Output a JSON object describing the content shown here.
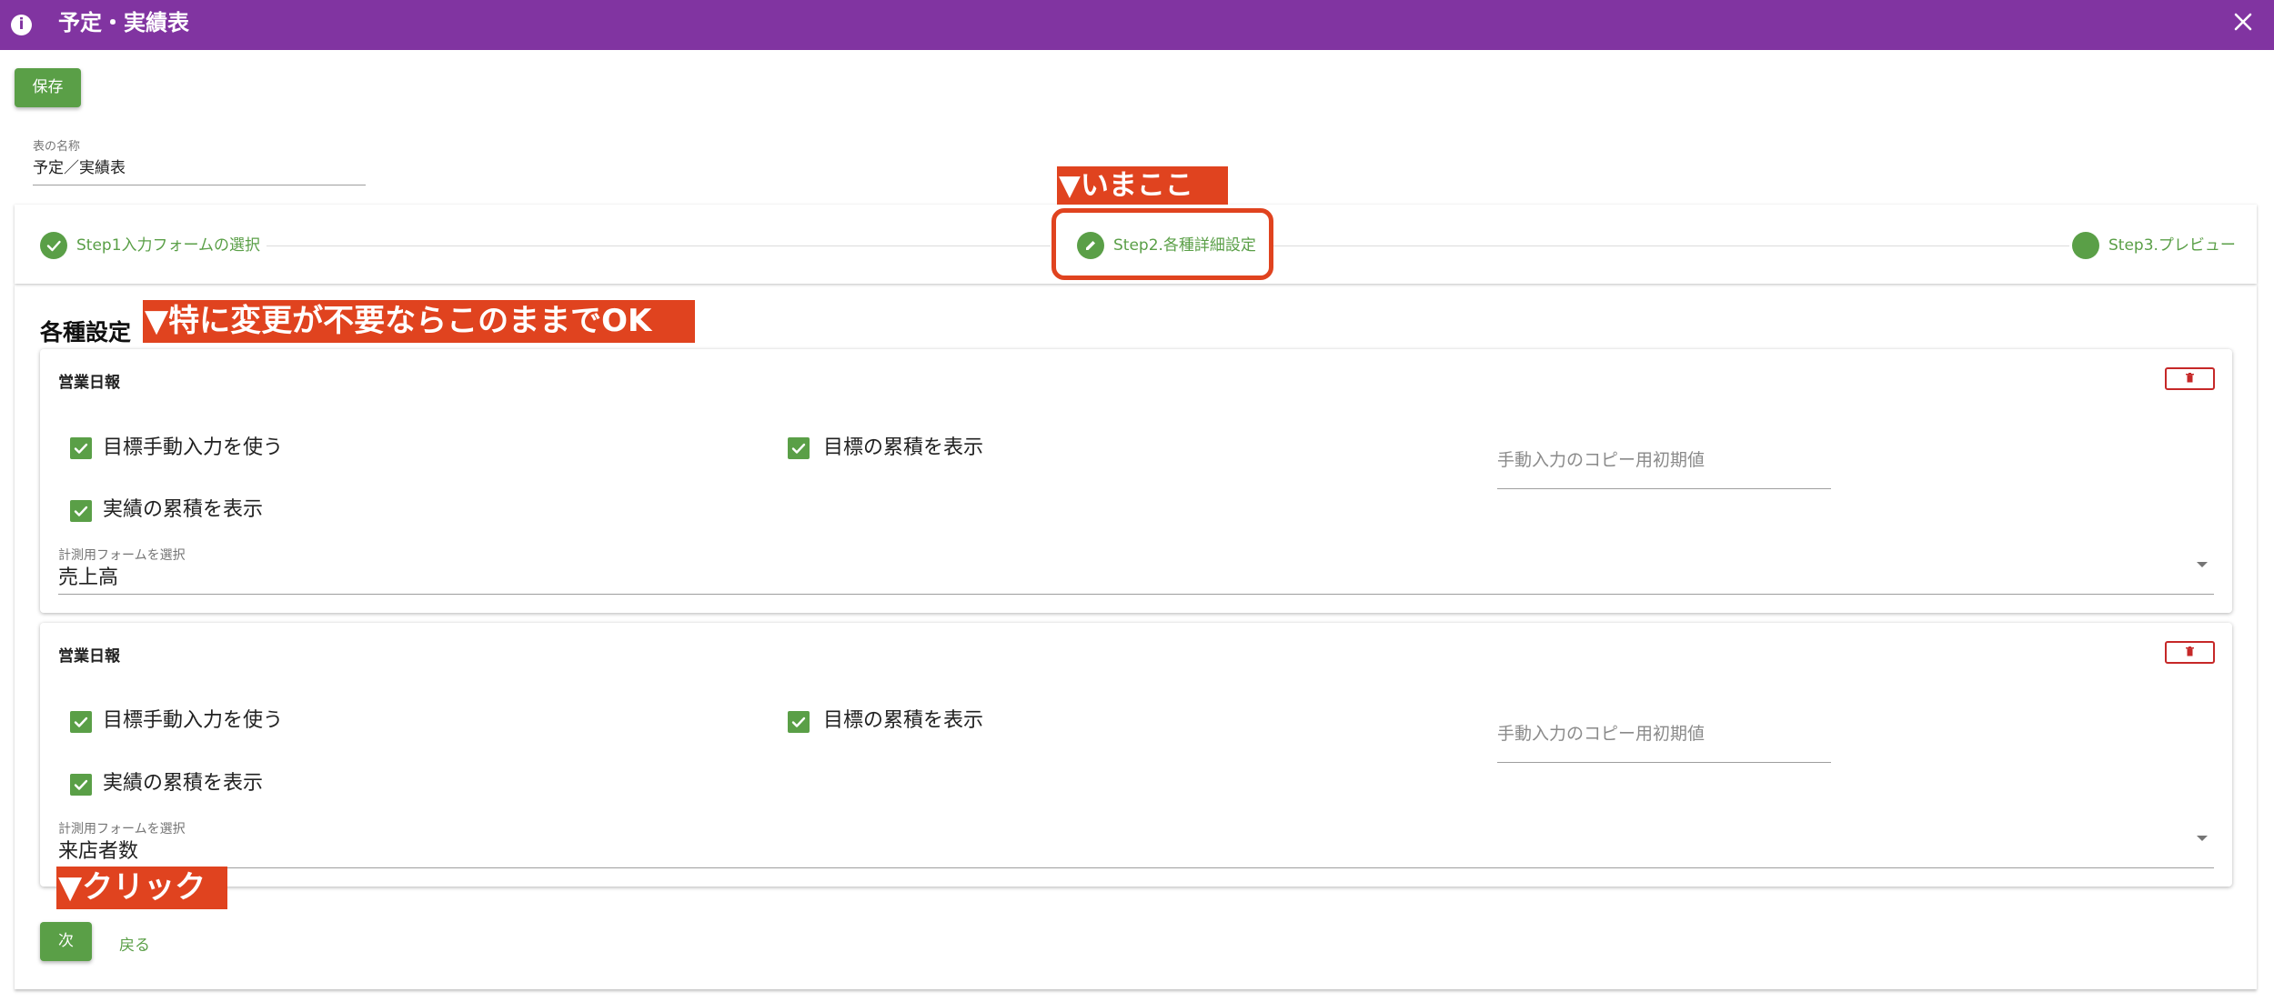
{
  "window": {
    "title": "予定・実績表",
    "info_icon": "info-icon",
    "close_icon": "close-icon"
  },
  "toolbar": {
    "save_label": "保存"
  },
  "name_field": {
    "label": "表の名称",
    "value": "予定／実績表"
  },
  "stepper": {
    "steps": [
      {
        "label": "Step1入力フォームの選択",
        "state": "completed",
        "icon": "check-icon"
      },
      {
        "label": "Step2.各種詳細設定",
        "state": "active",
        "icon": "pencil-icon"
      },
      {
        "label": "Step3.プレビュー",
        "state": "pending",
        "icon": "circle-icon"
      }
    ]
  },
  "annotations": {
    "current": "▼いまここ",
    "no_change": "▼特に変更が不要ならこのままでOK",
    "click": "▼クリック"
  },
  "settings": {
    "title": "各種設定",
    "cards": [
      {
        "title": "営業日報",
        "delete_icon": "trash-icon",
        "checkbox_target_manual": {
          "label": "目標手動入力を使う",
          "checked": true
        },
        "checkbox_target_cumulative": {
          "label": "目標の累積を表示",
          "checked": true
        },
        "checkbox_actual_cumulative": {
          "label": "実績の累積を表示",
          "checked": true
        },
        "copy_default_placeholder": "手動入力のコピー用初期値",
        "form_select": {
          "label": "計測用フォームを選択",
          "value": "売上高"
        }
      },
      {
        "title": "営業日報",
        "delete_icon": "trash-icon",
        "checkbox_target_manual": {
          "label": "目標手動入力を使う",
          "checked": true
        },
        "checkbox_target_cumulative": {
          "label": "目標の累積を表示",
          "checked": true
        },
        "checkbox_actual_cumulative": {
          "label": "実績の累積を表示",
          "checked": true
        },
        "copy_default_placeholder": "手動入力のコピー用初期値",
        "form_select": {
          "label": "計測用フォームを選択",
          "value": "来店者数"
        }
      }
    ]
  },
  "footer": {
    "next_label": "次",
    "back_label": "戻る"
  },
  "colors": {
    "title_bar": "#8134a1",
    "primary_green": "#5a9f47",
    "annotation_red": "#e0431f",
    "delete_red": "#c62828"
  }
}
